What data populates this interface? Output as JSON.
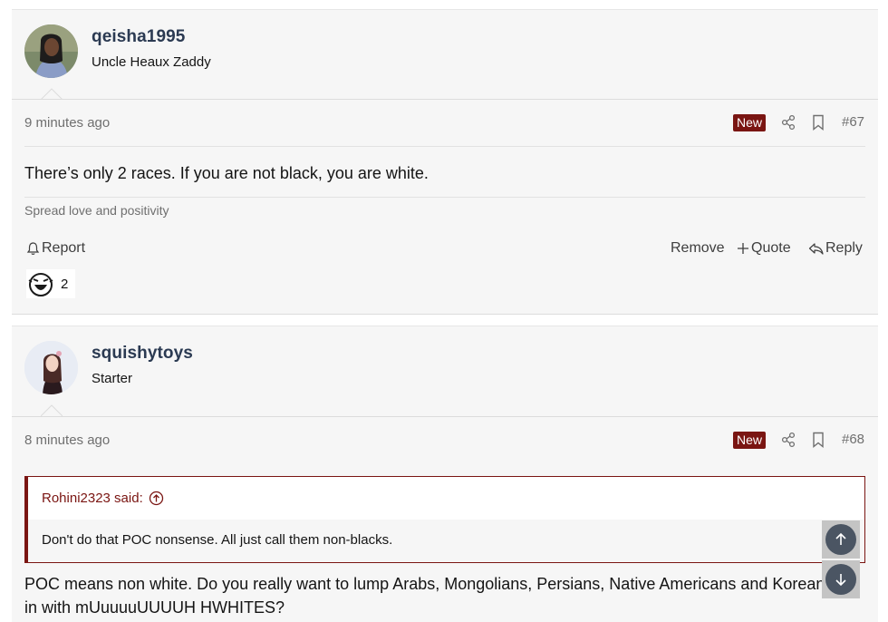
{
  "posts": [
    {
      "username": "qeisha1995",
      "user_title": "Uncle Heaux Zaddy",
      "time": "9 minutes ago",
      "badge": "New",
      "post_number": "#67",
      "body": "There’s only 2 races. If you are not black, you are white.",
      "signature": "Spread love and positivity",
      "actions": {
        "report": "Report",
        "remove": "Remove",
        "quote": "Quote",
        "reply": "Reply"
      },
      "reaction": {
        "icon": "laughing-reaction-icon",
        "count": "2"
      }
    },
    {
      "username": "squishytoys",
      "user_title": "Starter",
      "time": "8 minutes ago",
      "badge": "New",
      "post_number": "#68",
      "quote": {
        "author_line": "Rohini2323 said:",
        "text": "Don't do that POC nonsense. All just call them non-blacks."
      },
      "body_line1": "POC means non white. Do you really want to lump Arabs, Mongolians, Persians, Native Americans and Koreans",
      "body_line2": "in with mUuuuuUUUUH HWHITES?"
    }
  ],
  "colors": {
    "accent": "#7a1512",
    "username": "#2b3a52",
    "scroll_button": "#4b5563"
  }
}
